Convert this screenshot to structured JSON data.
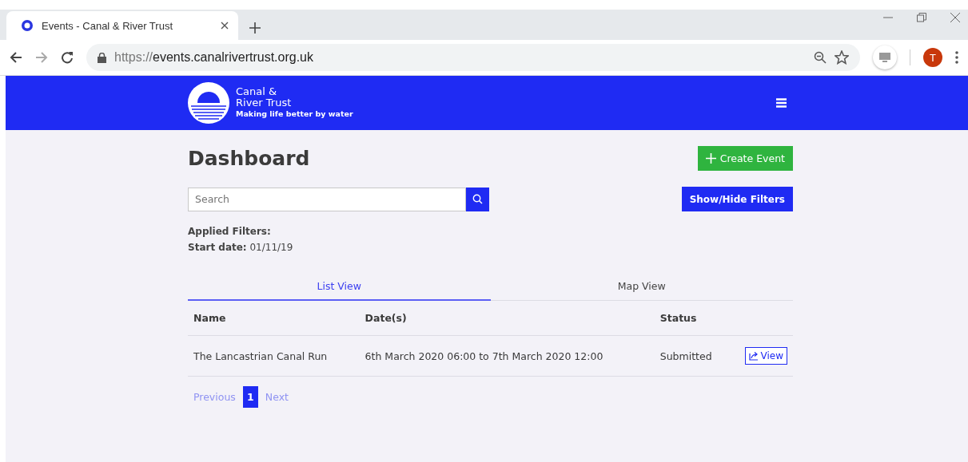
{
  "browser": {
    "tab_title": "Events - Canal & River Trust",
    "url_scheme": "https://",
    "url_host": "events.canalrivertrust.org.uk",
    "avatar": "T"
  },
  "header": {
    "logo_name_lines": [
      "Canal &",
      "River Trust"
    ],
    "tagline": "Making life better by water"
  },
  "page": {
    "title": "Dashboard",
    "create_button": "Create Event",
    "search": {
      "placeholder": "Search"
    },
    "filters_button": "Show/Hide Filters",
    "applied_filters_label": "Applied Filters:",
    "filters": [
      "**Start date:** 01/11/19"
    ]
  },
  "tabs": [
    {
      "label": "List View",
      "selected": true
    },
    {
      "label": "Map View",
      "selected": false
    }
  ],
  "table": {
    "columns": [
      "Name",
      "Date(s)",
      "Status"
    ],
    "rows": [
      {
        "name": "The Lancastrian Canal Run",
        "dates": "6th March 2020 06:00 to 7th March 2020 12:00",
        "status": "Submitted",
        "action": "View"
      }
    ]
  },
  "pagination": {
    "previous": "Previous",
    "pages": [
      {
        "label": "1",
        "selected": true
      }
    ],
    "next": "Next"
  }
}
